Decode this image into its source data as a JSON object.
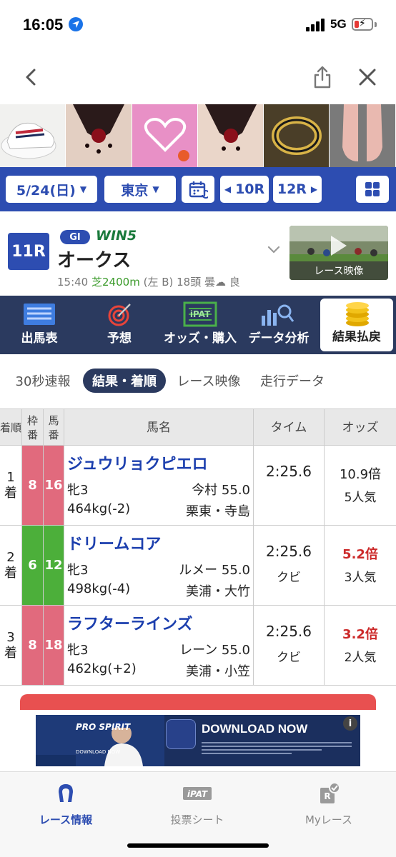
{
  "status_bar": {
    "time": "16:05",
    "network": "5G"
  },
  "nav": {
    "back": "back",
    "share": "share",
    "close": "close"
  },
  "date_bar": {
    "date": "5/24(日)",
    "venue": "東京",
    "prev_race": "10R",
    "next_race": "12R"
  },
  "race": {
    "number": "11R",
    "grade": "GI",
    "win5": "WIN5",
    "name": "オークス",
    "time": "15:40",
    "course": "芝2400m",
    "course_detail": "(左 B)",
    "runners": "18頭",
    "weather": "曇",
    "going": "良",
    "video_label": "レース映像"
  },
  "menu_tabs": [
    {
      "label": "出馬表",
      "icon": "list-icon"
    },
    {
      "label": "予想",
      "icon": "target-icon"
    },
    {
      "label": "オッズ・購入",
      "icon": "ipat-icon"
    },
    {
      "label": "データ分析",
      "icon": "chart-search-icon"
    },
    {
      "label": "結果払戻",
      "icon": "coins-icon",
      "active": true
    }
  ],
  "sub_tabs": [
    {
      "label": "30秒速報"
    },
    {
      "label": "結果・着順",
      "active": true
    },
    {
      "label": "レース映像"
    },
    {
      "label": "走行データ"
    }
  ],
  "table": {
    "headers": {
      "pos": "着順",
      "waku": "枠番",
      "uma": "馬番",
      "name": "馬名",
      "time": "タイム",
      "odds": "オッズ"
    },
    "rows": [
      {
        "pos_num": "1",
        "pos_suffix": "着",
        "waku": "8",
        "uma": "16",
        "waku_color": "#e16a7d",
        "horse": "ジュウリョクピエロ",
        "sex_age": "牝3",
        "jockey": "今村 55.0",
        "weight": "464kg(-2)",
        "trainer": "栗東・寺島",
        "time": "2:25.6",
        "margin": "",
        "odds": "10.9倍",
        "popularity": "5人気",
        "odds_highlight": false
      },
      {
        "pos_num": "2",
        "pos_suffix": "着",
        "waku": "6",
        "uma": "12",
        "waku_color": "#4caf3a",
        "horse": "ドリームコア",
        "sex_age": "牝3",
        "jockey": "ルメー 55.0",
        "weight": "498kg(-4)",
        "trainer": "美浦・大竹",
        "time": "2:25.6",
        "margin": "クビ",
        "odds": "5.2倍",
        "popularity": "3人気",
        "odds_highlight": true
      },
      {
        "pos_num": "3",
        "pos_suffix": "着",
        "waku": "8",
        "uma": "18",
        "waku_color": "#e16a7d",
        "horse": "ラフターラインズ",
        "sex_age": "牝3",
        "jockey": "レーン 55.0",
        "weight": "462kg(+2)",
        "trainer": "美浦・小笠",
        "time": "2:25.6",
        "margin": "クビ",
        "odds": "3.2倍",
        "popularity": "2人気",
        "odds_highlight": true
      }
    ]
  },
  "bottom_ad": {
    "headline": "DOWNLOAD NOW",
    "brand": "PRO SPIRIT",
    "sub": "DOWNLOAD NOW"
  },
  "tab_bar": [
    {
      "label": "レース情報",
      "icon": "horseshoe-icon",
      "active": true
    },
    {
      "label": "投票シート",
      "icon": "ipat-icon"
    },
    {
      "label": "Myレース",
      "icon": "my-race-icon"
    }
  ],
  "colors": {
    "brand_blue": "#2d4db1",
    "menu_navy": "#2b3a5f",
    "odds_red": "#cc2a2a"
  }
}
